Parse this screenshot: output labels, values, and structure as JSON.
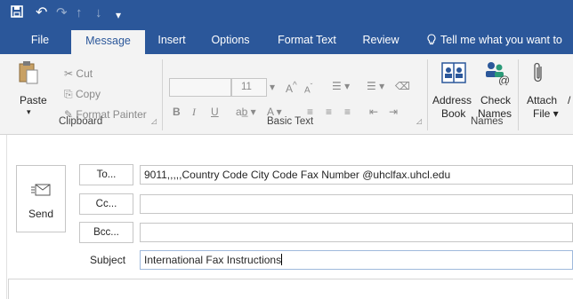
{
  "tabs": [
    "File",
    "Message",
    "Insert",
    "Options",
    "Format Text",
    "Review"
  ],
  "tell_me": "Tell me what you want to",
  "clipboard": {
    "paste": "Paste",
    "cut": "Cut",
    "copy": "Copy",
    "format_painter": "Format Painter",
    "label": "Clipboard"
  },
  "basic_text": {
    "font_size": "11",
    "label": "Basic Text",
    "bold": "B",
    "italic": "I",
    "underline": "U",
    "grow": "A",
    "shrink": "A"
  },
  "names": {
    "address_book_1": "Address",
    "address_book_2": "Book",
    "check_names_1": "Check",
    "check_names_2": "Names",
    "label": "Names"
  },
  "attach": {
    "line1": "Attach",
    "line2": "File"
  },
  "send": "Send",
  "to_button": "To...",
  "cc_button": "Cc...",
  "bcc_button": "Bcc...",
  "subject_label": "Subject",
  "to_value": "9011,,,,,Country Code City Code Fax Number @uhclfax.uhcl.edu",
  "cc_value": "",
  "bcc_value": "",
  "subject_value": "International Fax Instructions",
  "colors": {
    "brand": "#2b579a",
    "ribbon": "#f3f3f3"
  }
}
